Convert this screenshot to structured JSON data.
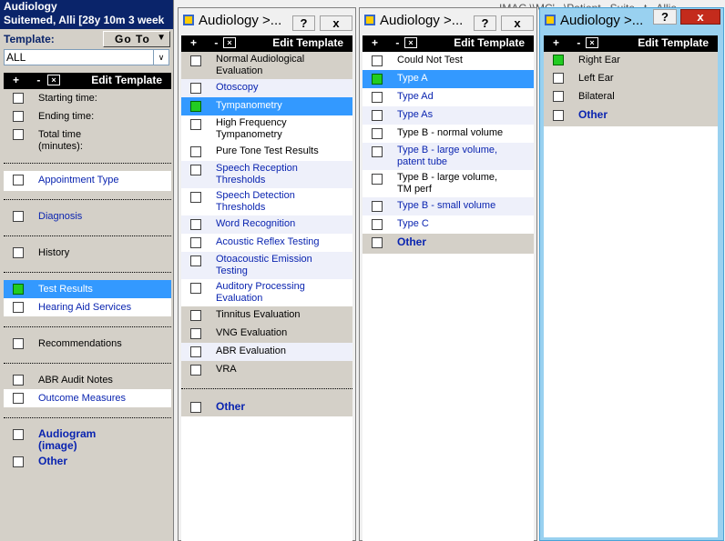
{
  "patient": {
    "line1": "Audiology",
    "line2": "Suitemed, Alli   [28y 10m 3 week"
  },
  "template": {
    "label": "Template:",
    "goto_label": "Go To",
    "combo_value": "ALL"
  },
  "toolbar": {
    "plus_minus": "+ -",
    "edit_label": "Edit Template"
  },
  "behind_window_text": "IMAC \\\\MC'...\\Patient...Suite...t...Allie",
  "left_items": [
    {
      "label": "Starting time:",
      "checked": false
    },
    {
      "label": "Ending time:",
      "checked": false
    },
    {
      "label": "Total time (minutes):",
      "checked": false
    },
    {
      "label": "Appointment Type",
      "checked": false
    },
    {
      "label": "Diagnosis",
      "checked": false
    },
    {
      "label": "History",
      "checked": false
    },
    {
      "label": "Test Results",
      "checked": true
    },
    {
      "label": "Hearing Aid Services",
      "checked": false
    },
    {
      "label": "Recommendations",
      "checked": false
    },
    {
      "label": "ABR Audit Notes",
      "checked": false
    },
    {
      "label": "Outcome Measures",
      "checked": false
    },
    {
      "label": "Audiogram (image)",
      "checked": false
    },
    {
      "label": "Other",
      "checked": false
    }
  ],
  "windows": [
    {
      "title": "Audiology >...",
      "help": "?",
      "close": "x",
      "items": [
        {
          "label": "Normal Audiological Evaluation",
          "checked": false
        },
        {
          "label": "Otoscopy",
          "checked": false
        },
        {
          "label": "Tympanometry",
          "checked": true
        },
        {
          "label": "High Frequency Tympanometry",
          "checked": false
        },
        {
          "label": "Pure Tone Test Results",
          "checked": false
        },
        {
          "label": "Speech Reception Thresholds",
          "checked": false
        },
        {
          "label": "Speech Detection Thresholds",
          "checked": false
        },
        {
          "label": "Word Recognition",
          "checked": false
        },
        {
          "label": "Acoustic Reflex Testing",
          "checked": false
        },
        {
          "label": "Otoacoustic Emission Testing",
          "checked": false
        },
        {
          "label": "Auditory Processing Evaluation",
          "checked": false
        },
        {
          "label": "Tinnitus Evaluation",
          "checked": false
        },
        {
          "label": "VNG Evaluation",
          "checked": false
        },
        {
          "label": "ABR Evaluation",
          "checked": false
        },
        {
          "label": "VRA",
          "checked": false
        },
        {
          "label": "Other",
          "checked": false
        }
      ]
    },
    {
      "title": "Audiology >...",
      "help": "?",
      "close": "x",
      "items": [
        {
          "label": "Could Not Test",
          "checked": false
        },
        {
          "label": "Type A",
          "checked": true
        },
        {
          "label": "Type Ad",
          "checked": false
        },
        {
          "label": "Type As",
          "checked": false
        },
        {
          "label": "Type B - normal volume",
          "checked": false
        },
        {
          "label": "Type B - large volume, patent tube",
          "checked": false
        },
        {
          "label": "Type B - large volume, TM perf",
          "checked": false
        },
        {
          "label": "Type B - small volume",
          "checked": false
        },
        {
          "label": "Type C",
          "checked": false
        },
        {
          "label": "Other",
          "checked": false
        }
      ]
    },
    {
      "title": "Audiology >...",
      "help": "?",
      "close": "x",
      "items": [
        {
          "label": "Right Ear",
          "checked": true
        },
        {
          "label": "Left Ear",
          "checked": false
        },
        {
          "label": "Bilateral",
          "checked": false
        },
        {
          "label": "Other",
          "checked": false
        }
      ]
    }
  ]
}
